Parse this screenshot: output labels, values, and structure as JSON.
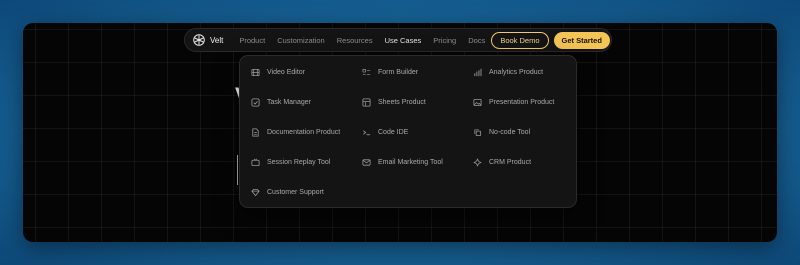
{
  "navbar": {
    "logo_text": "Velt",
    "items": [
      {
        "label": "Product",
        "active": false
      },
      {
        "label": "Customization",
        "active": false
      },
      {
        "label": "Resources",
        "active": false
      },
      {
        "label": "Use Cases",
        "active": true
      },
      {
        "label": "Pricing",
        "active": false
      },
      {
        "label": "Docs",
        "active": false
      }
    ],
    "book_demo_label": "Book Demo",
    "get_started_label": "Get Started"
  },
  "dropdown": {
    "columns": [
      [
        {
          "label": "Video Editor",
          "icon": "video-icon"
        },
        {
          "label": "Task Manager",
          "icon": "task-check-icon"
        },
        {
          "label": "Documentation Product",
          "icon": "document-icon"
        },
        {
          "label": "Session Replay Tool",
          "icon": "tv-icon"
        },
        {
          "label": "Customer Support",
          "icon": "diamond-icon"
        }
      ],
      [
        {
          "label": "Form Builder",
          "icon": "form-icon"
        },
        {
          "label": "Sheets Product",
          "icon": "table-icon"
        },
        {
          "label": "Code IDE",
          "icon": "terminal-icon"
        },
        {
          "label": "Email Marketing Tool",
          "icon": "mail-icon"
        }
      ],
      [
        {
          "label": "Analytics Product",
          "icon": "bar-chart-icon"
        },
        {
          "label": "Presentation Product",
          "icon": "image-icon"
        },
        {
          "label": "No-code Tool",
          "icon": "copy-icon"
        },
        {
          "label": "CRM Product",
          "icon": "sparkle-icon"
        }
      ]
    ]
  },
  "colors": {
    "accent": "#f4c456",
    "background": "#050505",
    "menu_bg": "#141414",
    "outer_bg": "#1a6a9f"
  }
}
